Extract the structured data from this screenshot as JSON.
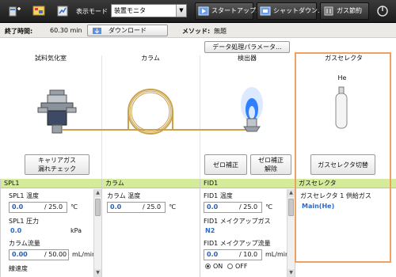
{
  "toolbar": {
    "display_mode_label": "表示モード",
    "display_mode_value": "装置モニタ",
    "startup_label": "スタートアップ...",
    "shutdown_label": "シャットダウン...",
    "gas_save_label": "ガス節約"
  },
  "info": {
    "end_time_label": "終了時間:",
    "end_time_value": "60.30 min",
    "download_label": "ダウンロード",
    "method_label": "メソッド:",
    "method_value": "無題"
  },
  "diagram": {
    "data_params_label": "データ処理パラメータ...",
    "sections": {
      "injector": "試料気化室",
      "column": "カラム",
      "detector": "検出器",
      "gas_selector": "ガスセレクタ"
    },
    "gas_name": "He",
    "carrier_check_line1": "キャリアガス",
    "carrier_check_line2": "漏れチェック",
    "zero_adjust": "ゼロ補正",
    "zero_release_line1": "ゼロ補正",
    "zero_release_line2": "解除",
    "gas_selector_switch": "ガスセレクタ切替"
  },
  "panels": {
    "spl1": {
      "title": "SPL1",
      "temp_label": "SPL1 温度",
      "temp_current": "0.0",
      "temp_setpoint": "/ 25.0",
      "temp_unit": "℃",
      "pressure_label": "SPL1 圧力",
      "pressure_value": "0.0",
      "pressure_unit": "kPa",
      "flow_label": "カラム流量",
      "flow_current": "0.00",
      "flow_setpoint": "/ 50.00",
      "flow_unit": "mL/min",
      "cut_label": "線速度"
    },
    "column": {
      "title": "カラム",
      "temp_label": "カラム 温度",
      "temp_current": "0.0",
      "temp_setpoint": "/ 25.0",
      "temp_unit": "℃"
    },
    "fid1": {
      "title": "FID1",
      "temp_label": "FID1 温度",
      "temp_current": "0.0",
      "temp_setpoint": "/ 25.0",
      "temp_unit": "℃",
      "makeup_gas_label": "FID1 メイクアップガス",
      "makeup_gas_value": "N2",
      "makeup_flow_label": "FID1 メイクアップ流量",
      "makeup_flow_current": "0.0",
      "makeup_flow_setpoint": "/ 10.0",
      "makeup_flow_unit": "mL/min",
      "on_label": "ON",
      "off_label": "OFF"
    },
    "gas_selector": {
      "title": "ガスセレクタ",
      "label": "ガスセレクタ 1 供給ガス",
      "value": "Main(He)"
    }
  },
  "colors": {
    "toolbar_bg": "#2a2a2a",
    "panel_header": "#d4ec9a",
    "highlight_border": "#f0a060",
    "value_blue": "#2a5db0",
    "flame_blue": "#2f7fff",
    "column_coil": "#c9a24a"
  }
}
